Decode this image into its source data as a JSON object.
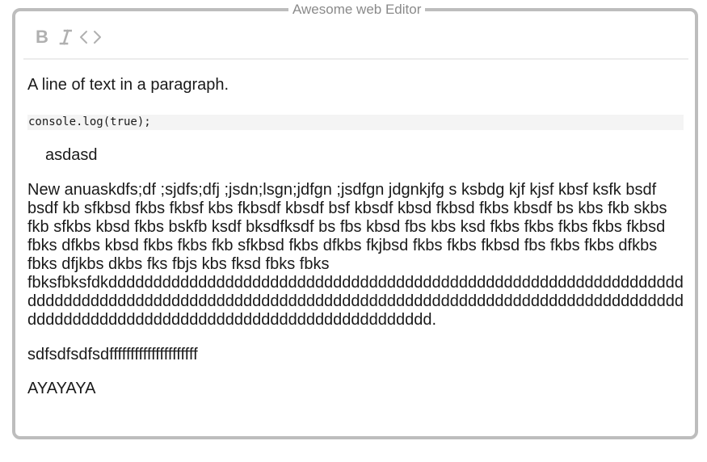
{
  "editor": {
    "title": "Awesome web Editor",
    "border_color": "#bdbdbd"
  },
  "toolbar": {
    "buttons": [
      {
        "icon": "bold-icon",
        "glyph": "B"
      },
      {
        "icon": "italic-icon"
      },
      {
        "icon": "code-icon"
      }
    ],
    "icon_color": "#b0b0b0"
  },
  "content": {
    "paragraph_1": "A line of text in a paragraph.",
    "code_block": "console.log(true);",
    "blockquote": "asdasd",
    "paragraph_long": "New anuaskdfs;df ;sjdfs;dfj ;jsdn;lsgn;jdfgn ;jsdfgn jdgnkjfg s ksbdg kjf kjsf kbsf ksfk bsdf bsdf kb sfkbsd fkbs fkbsf kbs fkbsdf kbsdf bsf kbsdf kbsd fkbsd fkbs kbsdf bs kbs fkb skbs fkb sfkbs kbsd fkbs bskfb ksdf bksdfksdf bs fbs kbsd fbs kbs ksd fkbs fkbs fkbs fkbs fkbsd fbks dfkbs kbsd fkbs fkbs fkb sfkbsd fkbs dfkbs fkjbsd fkbs fkbs fkbsd fbs fkbs fkbs dfkbs fbks dfjkbs dkbs fks fbjs kbs fksd fbks fbks fbksfbksfdkdddddddddddddddddddddddddddddddddddddddddddddddddddddddddddddddddddddddddddddddddddddddddddddddddddddddddddddddddddddddddddddddddddddddddddddddddddddddddddddddddddddddddddddddddddddd.",
    "paragraph_5": "sdfsdfsdfsdfffffffffffffffffffff",
    "paragraph_6": "AYAYAYA"
  }
}
